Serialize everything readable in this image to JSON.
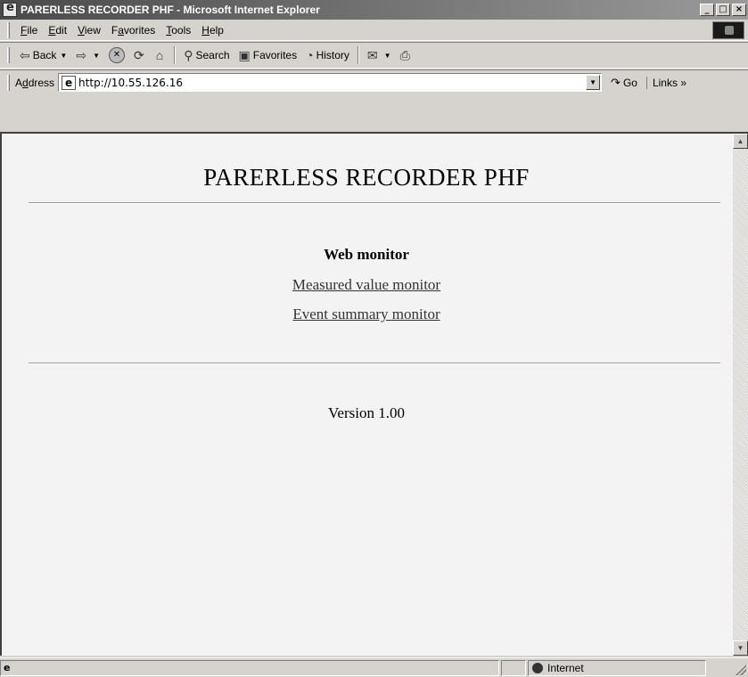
{
  "window": {
    "title": "PARERLESS RECORDER PHF - Microsoft Internet Explorer",
    "minimize_glyph": "_",
    "maximize_glyph": "□",
    "close_glyph": "×"
  },
  "menu": {
    "items": [
      {
        "label": "File",
        "accel": "F",
        "rest": "ile"
      },
      {
        "label": "Edit",
        "accel": "E",
        "rest": "dit"
      },
      {
        "label": "View",
        "accel": "V",
        "rest": "iew"
      },
      {
        "label": "Favorites",
        "pre": "F",
        "accel": "a",
        "rest": "vorites"
      },
      {
        "label": "Tools",
        "accel": "T",
        "rest": "ools"
      },
      {
        "label": "Help",
        "accel": "H",
        "rest": "elp"
      }
    ]
  },
  "toolbar": {
    "back_label": "Back",
    "search_label": "Search",
    "favorites_label": "Favorites",
    "history_label": "History"
  },
  "address": {
    "label_pre": "A",
    "label_accel": "d",
    "label_rest": "dress",
    "value": "http://10.55.126.16",
    "go_label": "Go",
    "links_label": "Links »"
  },
  "page": {
    "title": "PARERLESS RECORDER PHF",
    "heading": "Web monitor",
    "links": [
      "Measured value monitor",
      "Event summary monitor"
    ],
    "version": "Version 1.00"
  },
  "status": {
    "zone": "Internet"
  },
  "icons": {
    "app": "ie-logo-icon",
    "back": "back-arrow-icon",
    "forward": "forward-arrow-icon",
    "stop": "stop-icon",
    "refresh": "refresh-icon",
    "home": "home-icon",
    "search": "search-icon",
    "favorites": "favorites-icon",
    "history": "history-icon",
    "mail": "mail-icon",
    "print": "print-icon",
    "go": "go-arrow-icon",
    "globe": "globe-icon"
  }
}
